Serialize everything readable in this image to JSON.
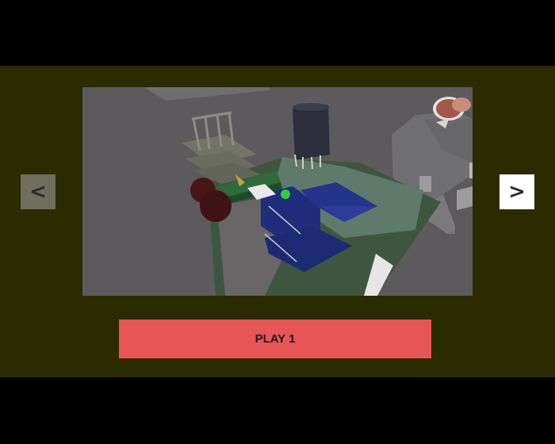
{
  "level_select": {
    "prev_label": "<",
    "next_label": ">",
    "play_label": "PLAY 1",
    "prev_icon": "chevron-left-icon",
    "next_icon": "chevron-right-icon"
  },
  "colors": {
    "page_background": "#000000",
    "panel_background": "#2b2b00",
    "preview_background": "#5c5a5d",
    "play_button": "#e85556",
    "prev_button": "#6e6e5e",
    "next_button": "#ffffff"
  }
}
